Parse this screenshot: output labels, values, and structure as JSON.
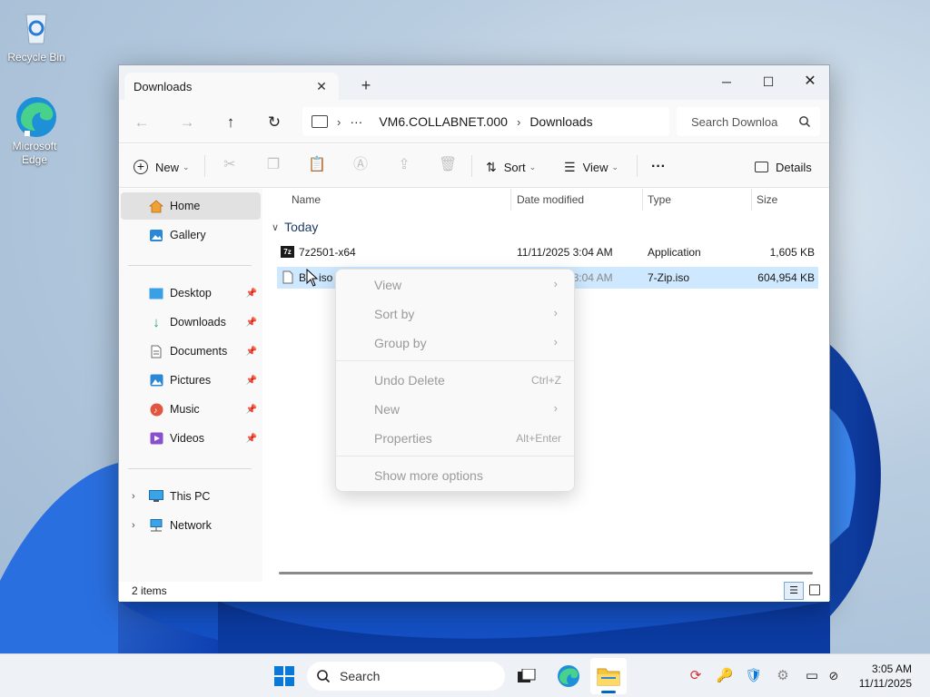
{
  "desktop": {
    "icons": [
      {
        "label": "Recycle Bin",
        "icon": "recycle-bin-icon"
      },
      {
        "label_line1": "Microsoft",
        "label_line2": "Edge",
        "icon": "edge-icon"
      }
    ]
  },
  "window": {
    "tab_title": "Downloads",
    "tab_close": "✕",
    "tab_add": "+",
    "controls": {
      "minimize": "─",
      "maximize": "☐",
      "close": "✕"
    }
  },
  "address": {
    "ellipsis": "···",
    "crumbs": [
      "VM6.COLLABNET.000",
      "Downloads"
    ],
    "separator": "›",
    "search_placeholder": "Search Downloa"
  },
  "toolbar": {
    "new_label": "New",
    "sort_label": "Sort",
    "view_label": "View",
    "more_label": "···",
    "details_label": "Details"
  },
  "sidebar": {
    "home": "Home",
    "gallery": "Gallery",
    "pinned": [
      "Desktop",
      "Downloads",
      "Documents",
      "Pictures",
      "Music",
      "Videos"
    ],
    "this_pc": "This PC",
    "network": "Network"
  },
  "columns": {
    "name": "Name",
    "date": "Date modified",
    "type": "Type",
    "size": "Size"
  },
  "group": {
    "label": "Today"
  },
  "files": [
    {
      "name": "7z2501-x64",
      "date": "11/11/2025 3:04 AM",
      "type": "Application",
      "size": "1,605 KB"
    },
    {
      "name": "B",
      "name_suffix": "iso",
      "date": "11/11/2025 3:04 AM",
      "type": "7-Zip.iso",
      "size": "604,954 KB"
    }
  ],
  "status": {
    "items": "2 items"
  },
  "context_menu": {
    "view": "View",
    "sort_by": "Sort by",
    "group_by": "Group by",
    "undo_delete": "Undo Delete",
    "undo_shortcut": "Ctrl+Z",
    "new": "New",
    "properties": "Properties",
    "properties_shortcut": "Alt+Enter",
    "show_more": "Show more options"
  },
  "taskbar": {
    "search_label": "Search",
    "time": "3:05 AM",
    "date": "11/11/2025"
  },
  "colors": {
    "accent": "#0067c0",
    "selection": "#cde8ff",
    "group_header": "#1f3a63"
  }
}
